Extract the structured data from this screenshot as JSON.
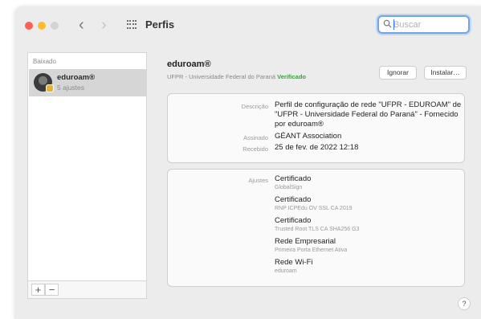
{
  "window": {
    "title": "Perfis"
  },
  "search": {
    "placeholder": "Buscar"
  },
  "sidebar": {
    "section_label": "Baixado",
    "items": [
      {
        "name": "eduroam®",
        "subtitle": "5 ajustes"
      }
    ],
    "add_label": "+",
    "remove_label": "−"
  },
  "profile": {
    "name": "eduroam®",
    "organization": "UFPR - Universidade Federal do Paraná",
    "verified": "Verificado",
    "ignore_label": "Ignorar",
    "install_label": "Instalar…",
    "info": {
      "description_label": "Descrição",
      "description_value": "Perfil de configuração de rede \"UFPR - EDUROAM\" de \"UFPR - Universidade Federal do Paraná\" - Fornecido por eduroam®",
      "signed_label": "Assinado",
      "signed_value": "GÉANT Association",
      "received_label": "Recebido",
      "received_value": "25 de fev. de 2022 12:18"
    },
    "settings_label": "Ajustes",
    "settings": [
      {
        "title": "Certificado",
        "subtitle": "GlobalSign"
      },
      {
        "title": "Certificado",
        "subtitle": "RNP ICPEdu OV SSL CA 2019"
      },
      {
        "title": "Certificado",
        "subtitle": "Trusted Root TLS CA SHA256 G3"
      },
      {
        "title": "Rede Empresarial",
        "subtitle": "Primeira Porta Ethernet Ativa"
      },
      {
        "title": "Rede Wi-Fi",
        "subtitle": "eduroam"
      }
    ]
  },
  "help_label": "?",
  "colors": {
    "accent": "#6ea6e8",
    "verified": "#3aa23a",
    "selection": "#d6d6d6"
  }
}
